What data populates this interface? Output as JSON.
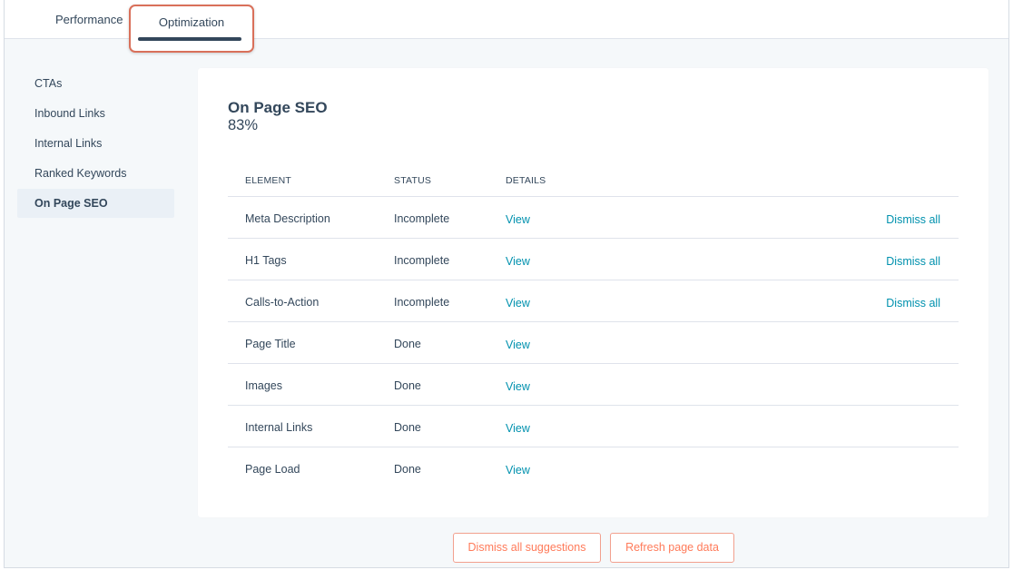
{
  "tabs": [
    {
      "label": "Performance"
    },
    {
      "label": "Optimization"
    }
  ],
  "sidebar": {
    "items": [
      {
        "label": "CTAs"
      },
      {
        "label": "Inbound Links"
      },
      {
        "label": "Internal Links"
      },
      {
        "label": "Ranked Keywords"
      },
      {
        "label": "On Page SEO"
      }
    ],
    "active": "On Page SEO"
  },
  "card": {
    "title": "On Page SEO",
    "score": "83%",
    "columns": {
      "element": "ELEMENT",
      "status": "STATUS",
      "details": "DETAILS"
    },
    "rows": [
      {
        "element": "Meta Description",
        "status": "Incomplete",
        "details": "View",
        "action": "Dismiss all"
      },
      {
        "element": "H1 Tags",
        "status": "Incomplete",
        "details": "View",
        "action": "Dismiss all"
      },
      {
        "element": "Calls-to-Action",
        "status": "Incomplete",
        "details": "View",
        "action": "Dismiss all"
      },
      {
        "element": "Page Title",
        "status": "Done",
        "details": "View"
      },
      {
        "element": "Images",
        "status": "Done",
        "details": "View"
      },
      {
        "element": "Internal Links",
        "status": "Done",
        "details": "View"
      },
      {
        "element": "Page Load",
        "status": "Done",
        "details": "View"
      }
    ]
  },
  "footer": {
    "dismiss_label": "Dismiss all suggestions",
    "refresh_label": "Refresh page data"
  },
  "colors": {
    "accent": "#ff7a59",
    "link": "#0091ae",
    "highlight_border": "#d9705a",
    "text": "#33475b"
  }
}
